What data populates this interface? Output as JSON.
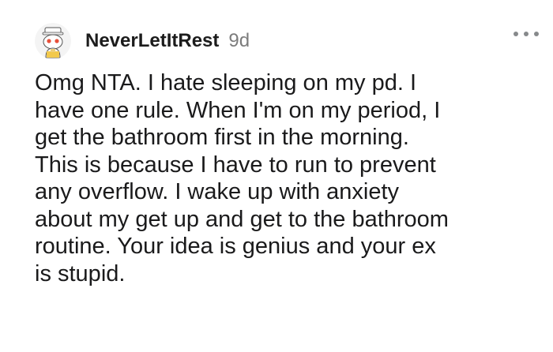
{
  "comment": {
    "username": "NeverLetItRest",
    "age": "9d",
    "avatar_icon": "snoo-avatar-icon",
    "more_icon": "more-options-icon",
    "body": "Omg NTA. I hate sleeping on my pd. I\nhave one rule. When I'm on my period, I\nget the bathroom first in the morning.\nThis is because I have to run to prevent\nany overflow. I wake up with anxiety\nabout my get up and get to the bathroom\nroutine. Your idea is genius and your ex\nis stupid."
  },
  "colors": {
    "username": "#1c1c1c",
    "meta": "#7c7c7c",
    "body": "#1a1a1b",
    "icon_gray": "#878a8c"
  }
}
